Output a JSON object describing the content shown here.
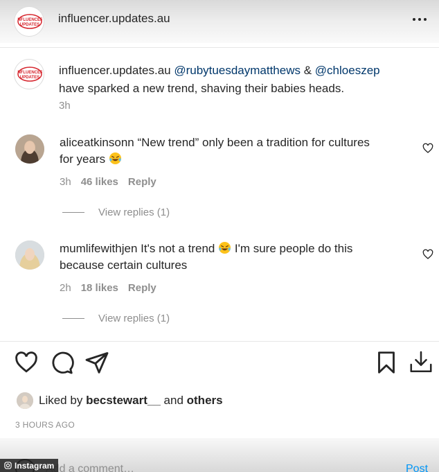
{
  "header": {
    "account": "influencer.updates.au",
    "logo_text": "INFLUENCER UPDATES"
  },
  "caption": {
    "username": "influencer.updates.au",
    "mention1": "@rubytuesdaymatthews",
    "amp": "&",
    "mention2": "@chloeszep",
    "text": "have sparked a new trend, shaving their babies heads.",
    "time": "3h"
  },
  "comments": [
    {
      "username": "aliceatkinsonn",
      "text_part1": "“New trend” only been a tradition for cultures for years",
      "emoji": "laughing-tears-emoji",
      "time": "3h",
      "likes": "46 likes",
      "reply": "Reply",
      "view_replies": "View replies (1)"
    },
    {
      "username": "mumlifewithjen",
      "text_part1": "It's not a trend",
      "emoji": "laughing-tears-emoji",
      "text_part2": "I'm sure people do this because certain cultures",
      "time": "2h",
      "likes": "18 likes",
      "reply": "Reply",
      "view_replies": "View replies (1)"
    }
  ],
  "likes": {
    "prefix": "Liked by",
    "user": "becstewart__",
    "and": "and",
    "others": "others"
  },
  "timestamp": "3 HOURS AGO",
  "composer": {
    "placeholder": "Add a comment…",
    "post_label": "Post"
  },
  "watermark": "Instagram",
  "colors": {
    "text": "#262626",
    "muted": "#8e8e8e",
    "mention": "#00376b",
    "brand_red": "#d6242c",
    "post_blue": "#0095f6"
  },
  "icons": [
    "more-icon",
    "heart-icon",
    "comment-icon",
    "share-icon",
    "bookmark-icon",
    "download-icon"
  ]
}
